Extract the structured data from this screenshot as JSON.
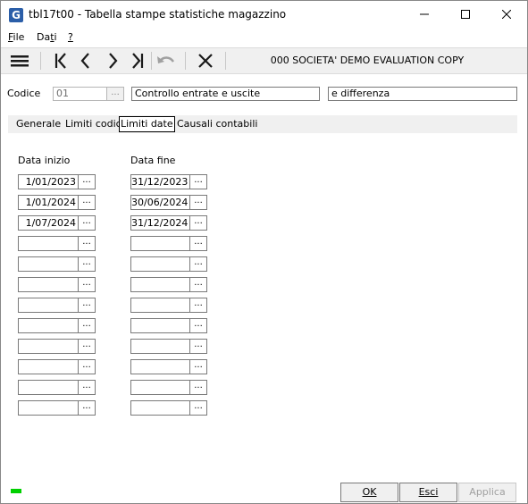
{
  "window": {
    "title": "tbl17t00 - Tabella stampe statistiche magazzino",
    "app_icon": "G",
    "controls": {
      "minimize": "minimize-icon",
      "maximize": "maximize-icon",
      "close": "close-icon"
    }
  },
  "menu": [
    {
      "label": "File",
      "underline": "F"
    },
    {
      "label": "Dati",
      "underline": "t"
    },
    {
      "label": "?",
      "underline": "?"
    }
  ],
  "toolbar": {
    "icons": [
      "menu-icon",
      "first-record-icon",
      "previous-record-icon",
      "next-record-icon",
      "last-record-icon",
      "undo-icon",
      "delete-icon"
    ],
    "company": "000 SOCIETA' DEMO EVALUATION COPY"
  },
  "header": {
    "codice_label": "Codice",
    "codice_value": "01",
    "lookup_label": "...",
    "description1": "Controllo entrate e uscite",
    "description2": "e differenza"
  },
  "tabs": [
    {
      "label": "Generale",
      "active": false
    },
    {
      "label": "Limiti codici",
      "active": false
    },
    {
      "label": "Limiti date",
      "active": true
    },
    {
      "label": "Causali contabili",
      "active": false
    }
  ],
  "dates": {
    "start_label": "Data inizio",
    "end_label": "Data fine",
    "button_label": "...",
    "rows": [
      {
        "start": "1/01/2023",
        "end": "31/12/2023"
      },
      {
        "start": "1/01/2024",
        "end": "30/06/2024"
      },
      {
        "start": "1/07/2024",
        "end": "31/12/2024"
      },
      {
        "start": "",
        "end": ""
      },
      {
        "start": "",
        "end": ""
      },
      {
        "start": "",
        "end": ""
      },
      {
        "start": "",
        "end": ""
      },
      {
        "start": "",
        "end": ""
      },
      {
        "start": "",
        "end": ""
      },
      {
        "start": "",
        "end": ""
      },
      {
        "start": "",
        "end": ""
      },
      {
        "start": "",
        "end": ""
      }
    ]
  },
  "footer": {
    "ok": "OK",
    "esci": "Esci",
    "applica": "Applica",
    "status_color": "#00d000"
  }
}
